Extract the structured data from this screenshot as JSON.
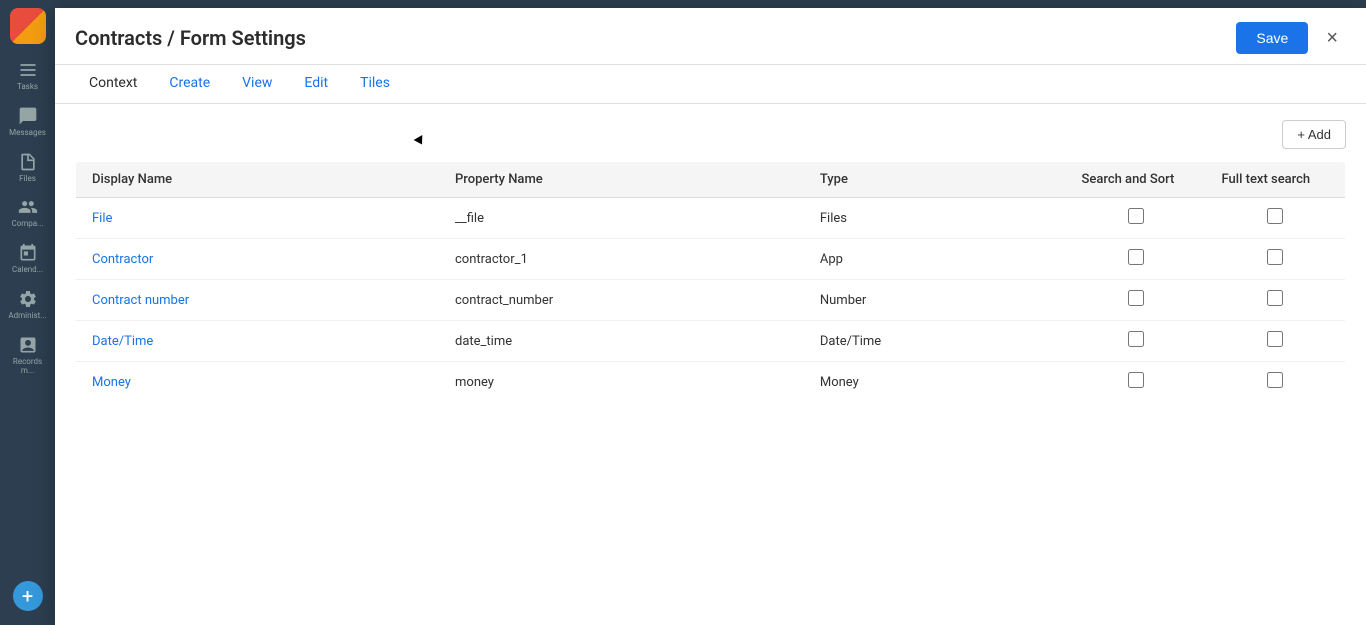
{
  "sidebar": {
    "items": [
      {
        "id": "tasks",
        "label": "Tasks",
        "icon": "tasks"
      },
      {
        "id": "messages",
        "label": "Messages",
        "icon": "messages"
      },
      {
        "id": "files",
        "label": "Files",
        "icon": "files"
      },
      {
        "id": "companies",
        "label": "Compa...",
        "icon": "companies"
      },
      {
        "id": "calendar",
        "label": "Calend...",
        "icon": "calendar"
      },
      {
        "id": "admin",
        "label": "Administ...",
        "icon": "admin"
      },
      {
        "id": "records",
        "label": "Records m...",
        "icon": "records"
      }
    ],
    "add_label": "+"
  },
  "modal": {
    "title": "Contracts / Form Settings",
    "save_label": "Save",
    "close_label": "×",
    "tabs": [
      {
        "id": "context",
        "label": "Context",
        "active": true
      },
      {
        "id": "create",
        "label": "Create",
        "link": true
      },
      {
        "id": "view",
        "label": "View",
        "link": true
      },
      {
        "id": "edit",
        "label": "Edit",
        "link": true
      },
      {
        "id": "tiles",
        "label": "Tiles",
        "link": true
      }
    ],
    "add_button_label": "+ Add",
    "table": {
      "headers": [
        {
          "id": "display_name",
          "label": "Display Name"
        },
        {
          "id": "property_name",
          "label": "Property Name"
        },
        {
          "id": "type",
          "label": "Type"
        },
        {
          "id": "search_sort",
          "label": "Search and Sort"
        },
        {
          "id": "full_text_search",
          "label": "Full text search"
        }
      ],
      "rows": [
        {
          "display_name": "File",
          "property_name": "__file",
          "type": "Files",
          "search_sort": false,
          "full_text_search": false
        },
        {
          "display_name": "Contractor",
          "property_name": "contractor_1",
          "type": "App",
          "search_sort": false,
          "full_text_search": false
        },
        {
          "display_name": "Contract number",
          "property_name": "contract_number",
          "type": "Number",
          "search_sort": false,
          "full_text_search": false
        },
        {
          "display_name": "Date/Time",
          "property_name": "date_time",
          "type": "Date/Time",
          "search_sort": false,
          "full_text_search": false
        },
        {
          "display_name": "Money",
          "property_name": "money",
          "type": "Money",
          "search_sort": false,
          "full_text_search": false
        }
      ]
    }
  }
}
